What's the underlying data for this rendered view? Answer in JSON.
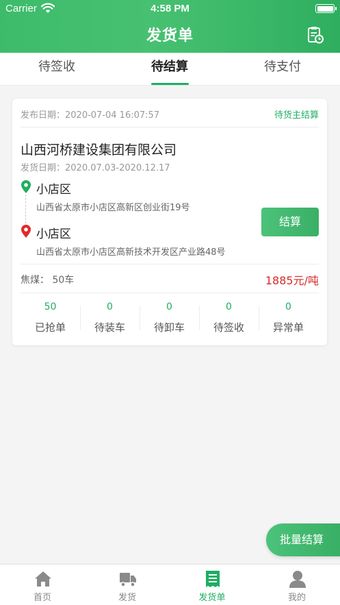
{
  "status_bar": {
    "carrier": "Carrier",
    "time": "4:58 PM"
  },
  "nav": {
    "title": "发货单",
    "right_icon": "clipboard-clock-icon"
  },
  "tabs": [
    {
      "label": "待签收",
      "active": false
    },
    {
      "label": "待结算",
      "active": true
    },
    {
      "label": "待支付",
      "active": false
    }
  ],
  "card": {
    "publish_date": "发布日期：2020-07-04 16:07:57",
    "status": "待货主结算",
    "company": "山西河桥建设集团有限公司",
    "ship_date": "发货日期：2020.07.03-2020.12.17",
    "origin": {
      "place": "小店区",
      "address": "山西省太原市小店区高新区创业街19号"
    },
    "destination": {
      "place": "小店区",
      "address": "山西省太原市小店区高新技术开发区产业路48号"
    },
    "settle_label": "结算",
    "cargo": "焦煤：  50车",
    "price": "1885元/吨",
    "stats": [
      {
        "value": "50",
        "label": "已抢单"
      },
      {
        "value": "0",
        "label": "待装车"
      },
      {
        "value": "0",
        "label": "待卸车"
      },
      {
        "value": "0",
        "label": "待签收"
      },
      {
        "value": "0",
        "label": "异常单"
      }
    ]
  },
  "batch_settle_label": "批量结算",
  "tabbar": [
    {
      "label": "首页",
      "icon": "home-icon",
      "active": false
    },
    {
      "label": "发货",
      "icon": "truck-icon",
      "active": false
    },
    {
      "label": "发货单",
      "icon": "receipt-icon",
      "active": true
    },
    {
      "label": "我的",
      "icon": "user-icon",
      "active": false
    }
  ],
  "colors": {
    "accent": "#1fae62",
    "header": "#3dbb6b",
    "price": "#d62b2b",
    "origin_pin": "#1fae62",
    "destination_pin": "#e02a2a"
  }
}
